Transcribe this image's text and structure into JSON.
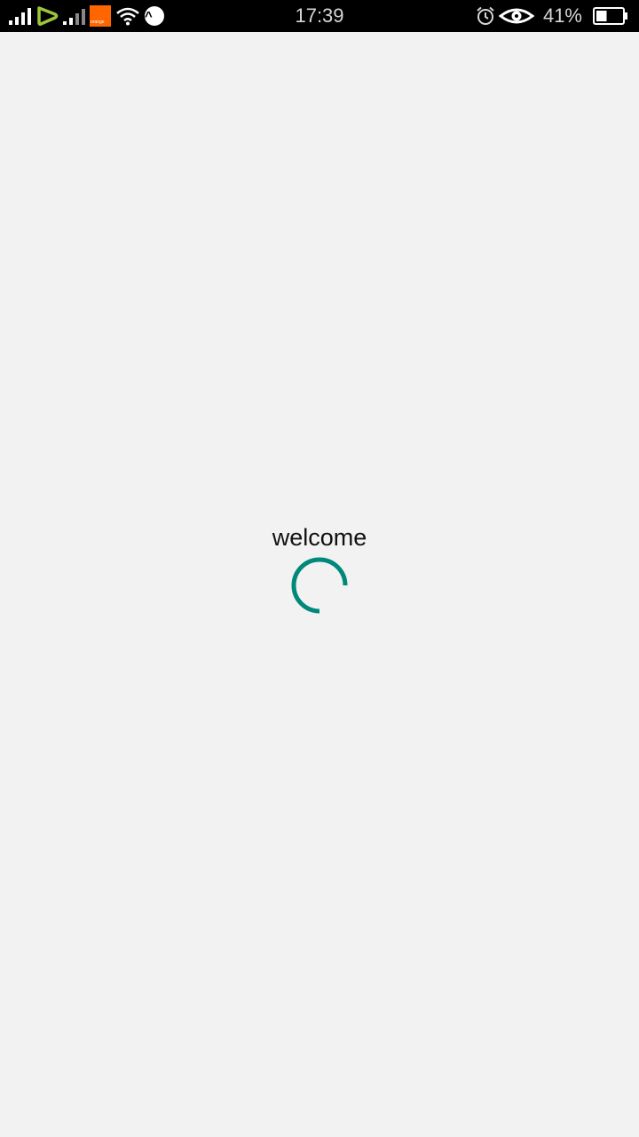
{
  "status_bar": {
    "time": "17:39",
    "battery_percent": "41%",
    "battery_level": 0.41,
    "carrier_logo_text": "orange",
    "icons": [
      "signal-icon",
      "etisalat-icon",
      "signal-icon",
      "orange-logo-icon",
      "wifi-icon",
      "app-notification-icon",
      "alarm-icon",
      "eye-comfort-icon",
      "battery-icon"
    ]
  },
  "main": {
    "welcome_text": "welcome",
    "spinner_color": "#00897b"
  }
}
